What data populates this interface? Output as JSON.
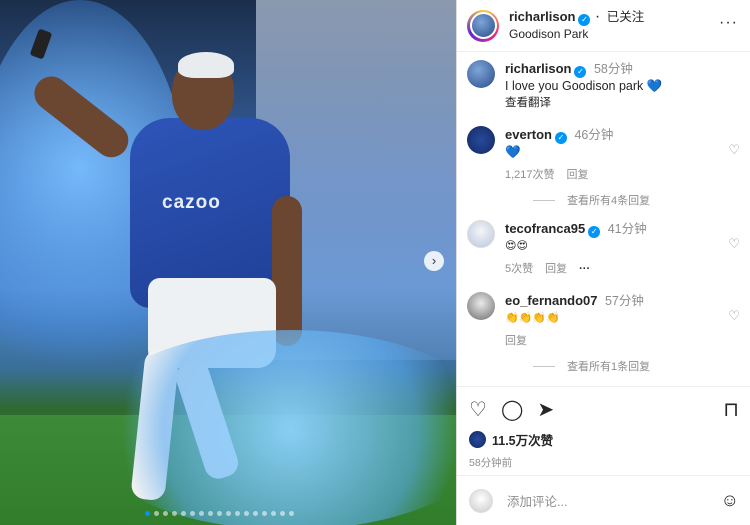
{
  "post": {
    "author": "richarlison",
    "follow_status": "已关注",
    "location": "Goodison Park",
    "more_label": "···",
    "caption": {
      "user": "richarlison",
      "time": "58分钟",
      "text": "I love you Goodison park 💙",
      "translate": "查看翻译"
    },
    "photo": {
      "sponsor_text": "cazoo",
      "next_label": "›",
      "page_dots": 17,
      "active_dot": 0
    }
  },
  "comments": [
    {
      "user": "everton",
      "verified": true,
      "time": "46分钟",
      "text": "💙",
      "likes": "1,217次赞",
      "reply": "回复",
      "view_replies": "查看所有4条回复"
    },
    {
      "user": "tecofranca95",
      "verified": true,
      "time": "41分钟",
      "text": "😍😍",
      "likes": "5次赞",
      "reply": "回复",
      "more": "···"
    },
    {
      "user": "eo_fernando07",
      "verified": false,
      "time": "57分钟",
      "text": "👏👏👏👏",
      "reply": "回复",
      "view_replies": "查看所有1条回复"
    }
  ],
  "actions": {
    "like_icon": "heart-icon",
    "comment_icon": "comment-icon",
    "share_icon": "share-icon",
    "save_icon": "bookmark-icon",
    "likes_count": "11.5万次赞",
    "time_ago": "58分钟前"
  },
  "add_comment": {
    "placeholder": "添加评论...",
    "emoji_icon": "smile-icon"
  },
  "colors": {
    "accent": "#0095f6",
    "everton_blue": "#274a9e"
  }
}
